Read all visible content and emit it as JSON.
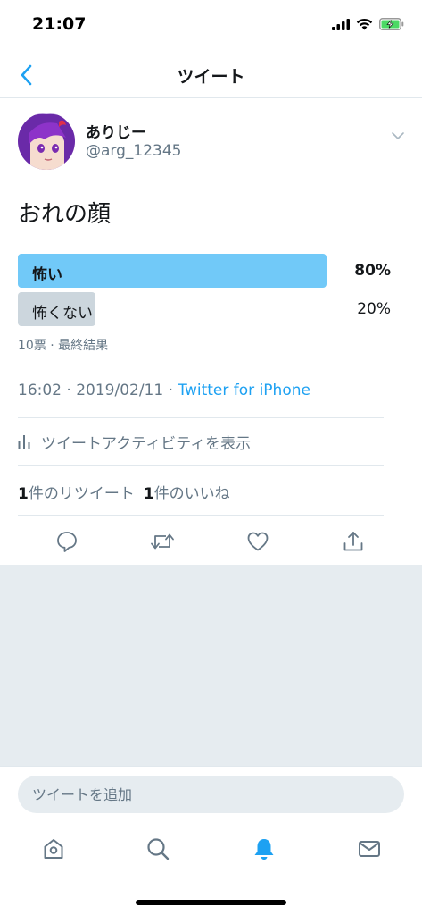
{
  "status_bar": {
    "time": "21:07"
  },
  "nav": {
    "title": "ツイート"
  },
  "tweet": {
    "author": {
      "display_name": "ありじー",
      "handle": "@arg_12345"
    },
    "text": "おれの顔",
    "poll": {
      "options": [
        {
          "label": "怖い",
          "percent_text": "80%",
          "percent": 80,
          "winner": true
        },
        {
          "label": "怖くない",
          "percent_text": "20%",
          "percent": 20,
          "winner": false
        }
      ],
      "meta": "10票 · 最終結果"
    },
    "time_text": "16:02 · 2019/02/11 · ",
    "source": "Twitter for iPhone",
    "activity_label": "ツイートアクティビティを表示",
    "retweets": {
      "count": "1",
      "label": "件のリツイート"
    },
    "likes": {
      "count": "1",
      "label": "件のいいね"
    }
  },
  "reply": {
    "placeholder": "ツイートを追加"
  },
  "colors": {
    "accent": "#1da1f2",
    "poll_winner": "#71c9f8",
    "poll_loser": "#ccd6dd",
    "muted": "#657786",
    "background_grey": "#e6ecf0"
  },
  "icons": {
    "action_bar": [
      "reply-icon",
      "retweet-icon",
      "like-icon",
      "share-icon"
    ],
    "tab_bar": [
      "home-icon",
      "search-icon",
      "notifications-icon",
      "messages-icon"
    ]
  }
}
